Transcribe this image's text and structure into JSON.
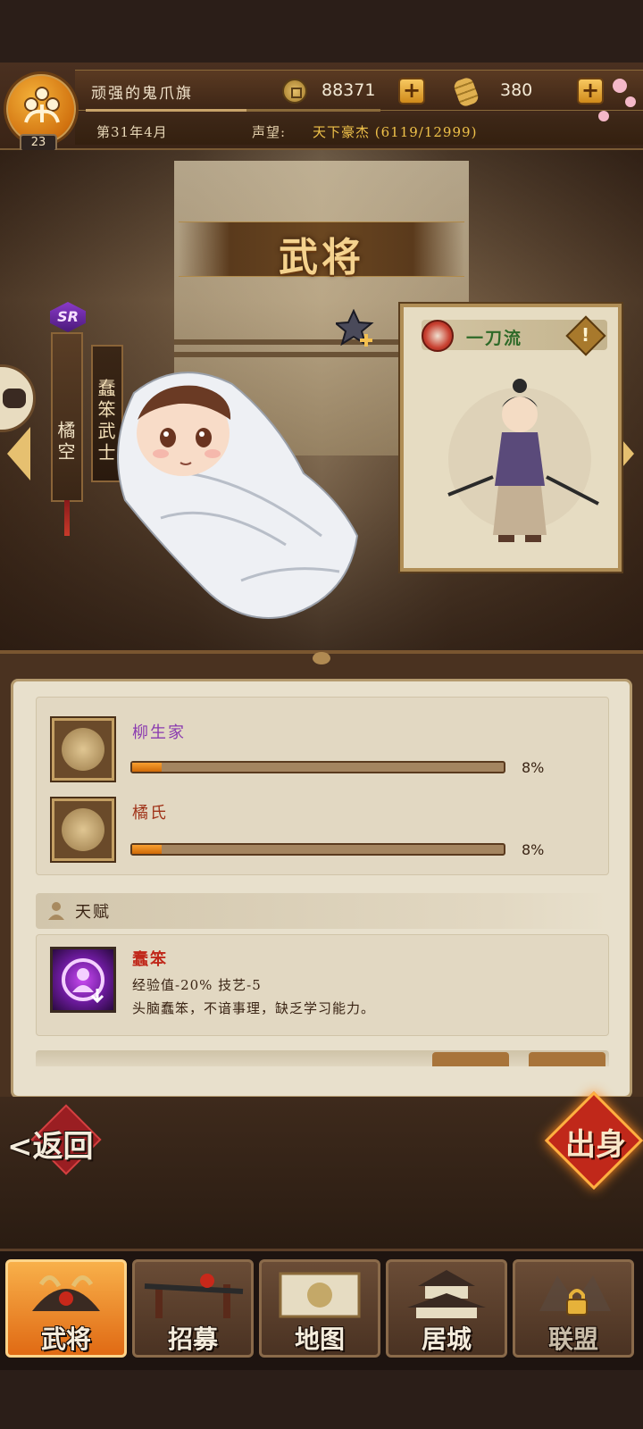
{
  "header": {
    "player_name": "顽强的鬼爪旗",
    "level": "23",
    "gold": "88371",
    "rice": "380",
    "date": "第31年4月",
    "fame_label": "声望:",
    "fame_value": "天下豪杰 (6119/12999)"
  },
  "scene": {
    "title": "武将",
    "rarity": "SR",
    "general_name": "橘空",
    "general_title": "蠢笨武士",
    "skill_card": {
      "name": "一刀流",
      "type_icon": "crossed-swords-icon",
      "info_icon": "exclamation-icon"
    }
  },
  "origins": [
    {
      "name": "柳生家",
      "name_color": "#8a3ab0",
      "percent": "8%",
      "progress": 0.08,
      "icon": "yagyu-crest-icon"
    },
    {
      "name": "橘氏",
      "name_color": "#a0341a",
      "percent": "8%",
      "progress": 0.08,
      "icon": "tachibana-crest-icon"
    }
  ],
  "talent": {
    "header": "天赋",
    "name": "蠢笨",
    "effect": "经验值-20%   技艺-5",
    "description": "头脑蠢笨，不谙事理，缺乏学习能力。",
    "icon": "person-down-icon"
  },
  "actions": {
    "back_label": "返回",
    "birth_label": "出身"
  },
  "nav": [
    {
      "label": "武将",
      "icon": "samurai-helmet-icon",
      "active": true,
      "locked": false
    },
    {
      "label": "招募",
      "icon": "katana-rack-icon",
      "active": false,
      "locked": false
    },
    {
      "label": "地图",
      "icon": "scroll-map-icon",
      "active": false,
      "locked": false
    },
    {
      "label": "居城",
      "icon": "castle-icon",
      "active": false,
      "locked": false
    },
    {
      "label": "联盟",
      "icon": "alliance-icon",
      "active": false,
      "locked": true
    }
  ],
  "colors": {
    "accent_orange": "#e06a14",
    "gold_text": "#f0c24a",
    "panel_bg": "#e8e0cc",
    "progress_fill": "#f8a030"
  }
}
